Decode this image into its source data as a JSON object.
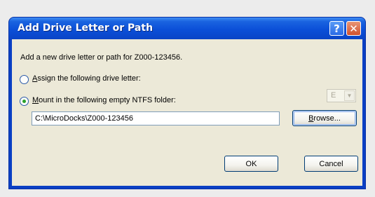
{
  "dialog": {
    "title": "Add Drive Letter or Path",
    "help_glyph": "?",
    "close_glyph": "✕",
    "description": "Add a new drive letter or path for Z000-123456.",
    "assign_option": {
      "label_u": "A",
      "label_rest": "ssign the following drive letter:",
      "selected": false
    },
    "drive_letter": {
      "value": "E",
      "arrow": "▼"
    },
    "mount_option": {
      "label_u": "M",
      "label_rest": "ount in the following empty NTFS folder:",
      "selected": true
    },
    "mount_path": "C:\\MicroDocks\\Z000-123456",
    "browse_label": {
      "u": "B",
      "rest": "rowse..."
    },
    "ok_label": "OK",
    "cancel_label": "Cancel"
  },
  "colors": {
    "titlebar": "#0b4fd8",
    "client_bg": "#ece9d8",
    "close_button": "#d1512e"
  }
}
